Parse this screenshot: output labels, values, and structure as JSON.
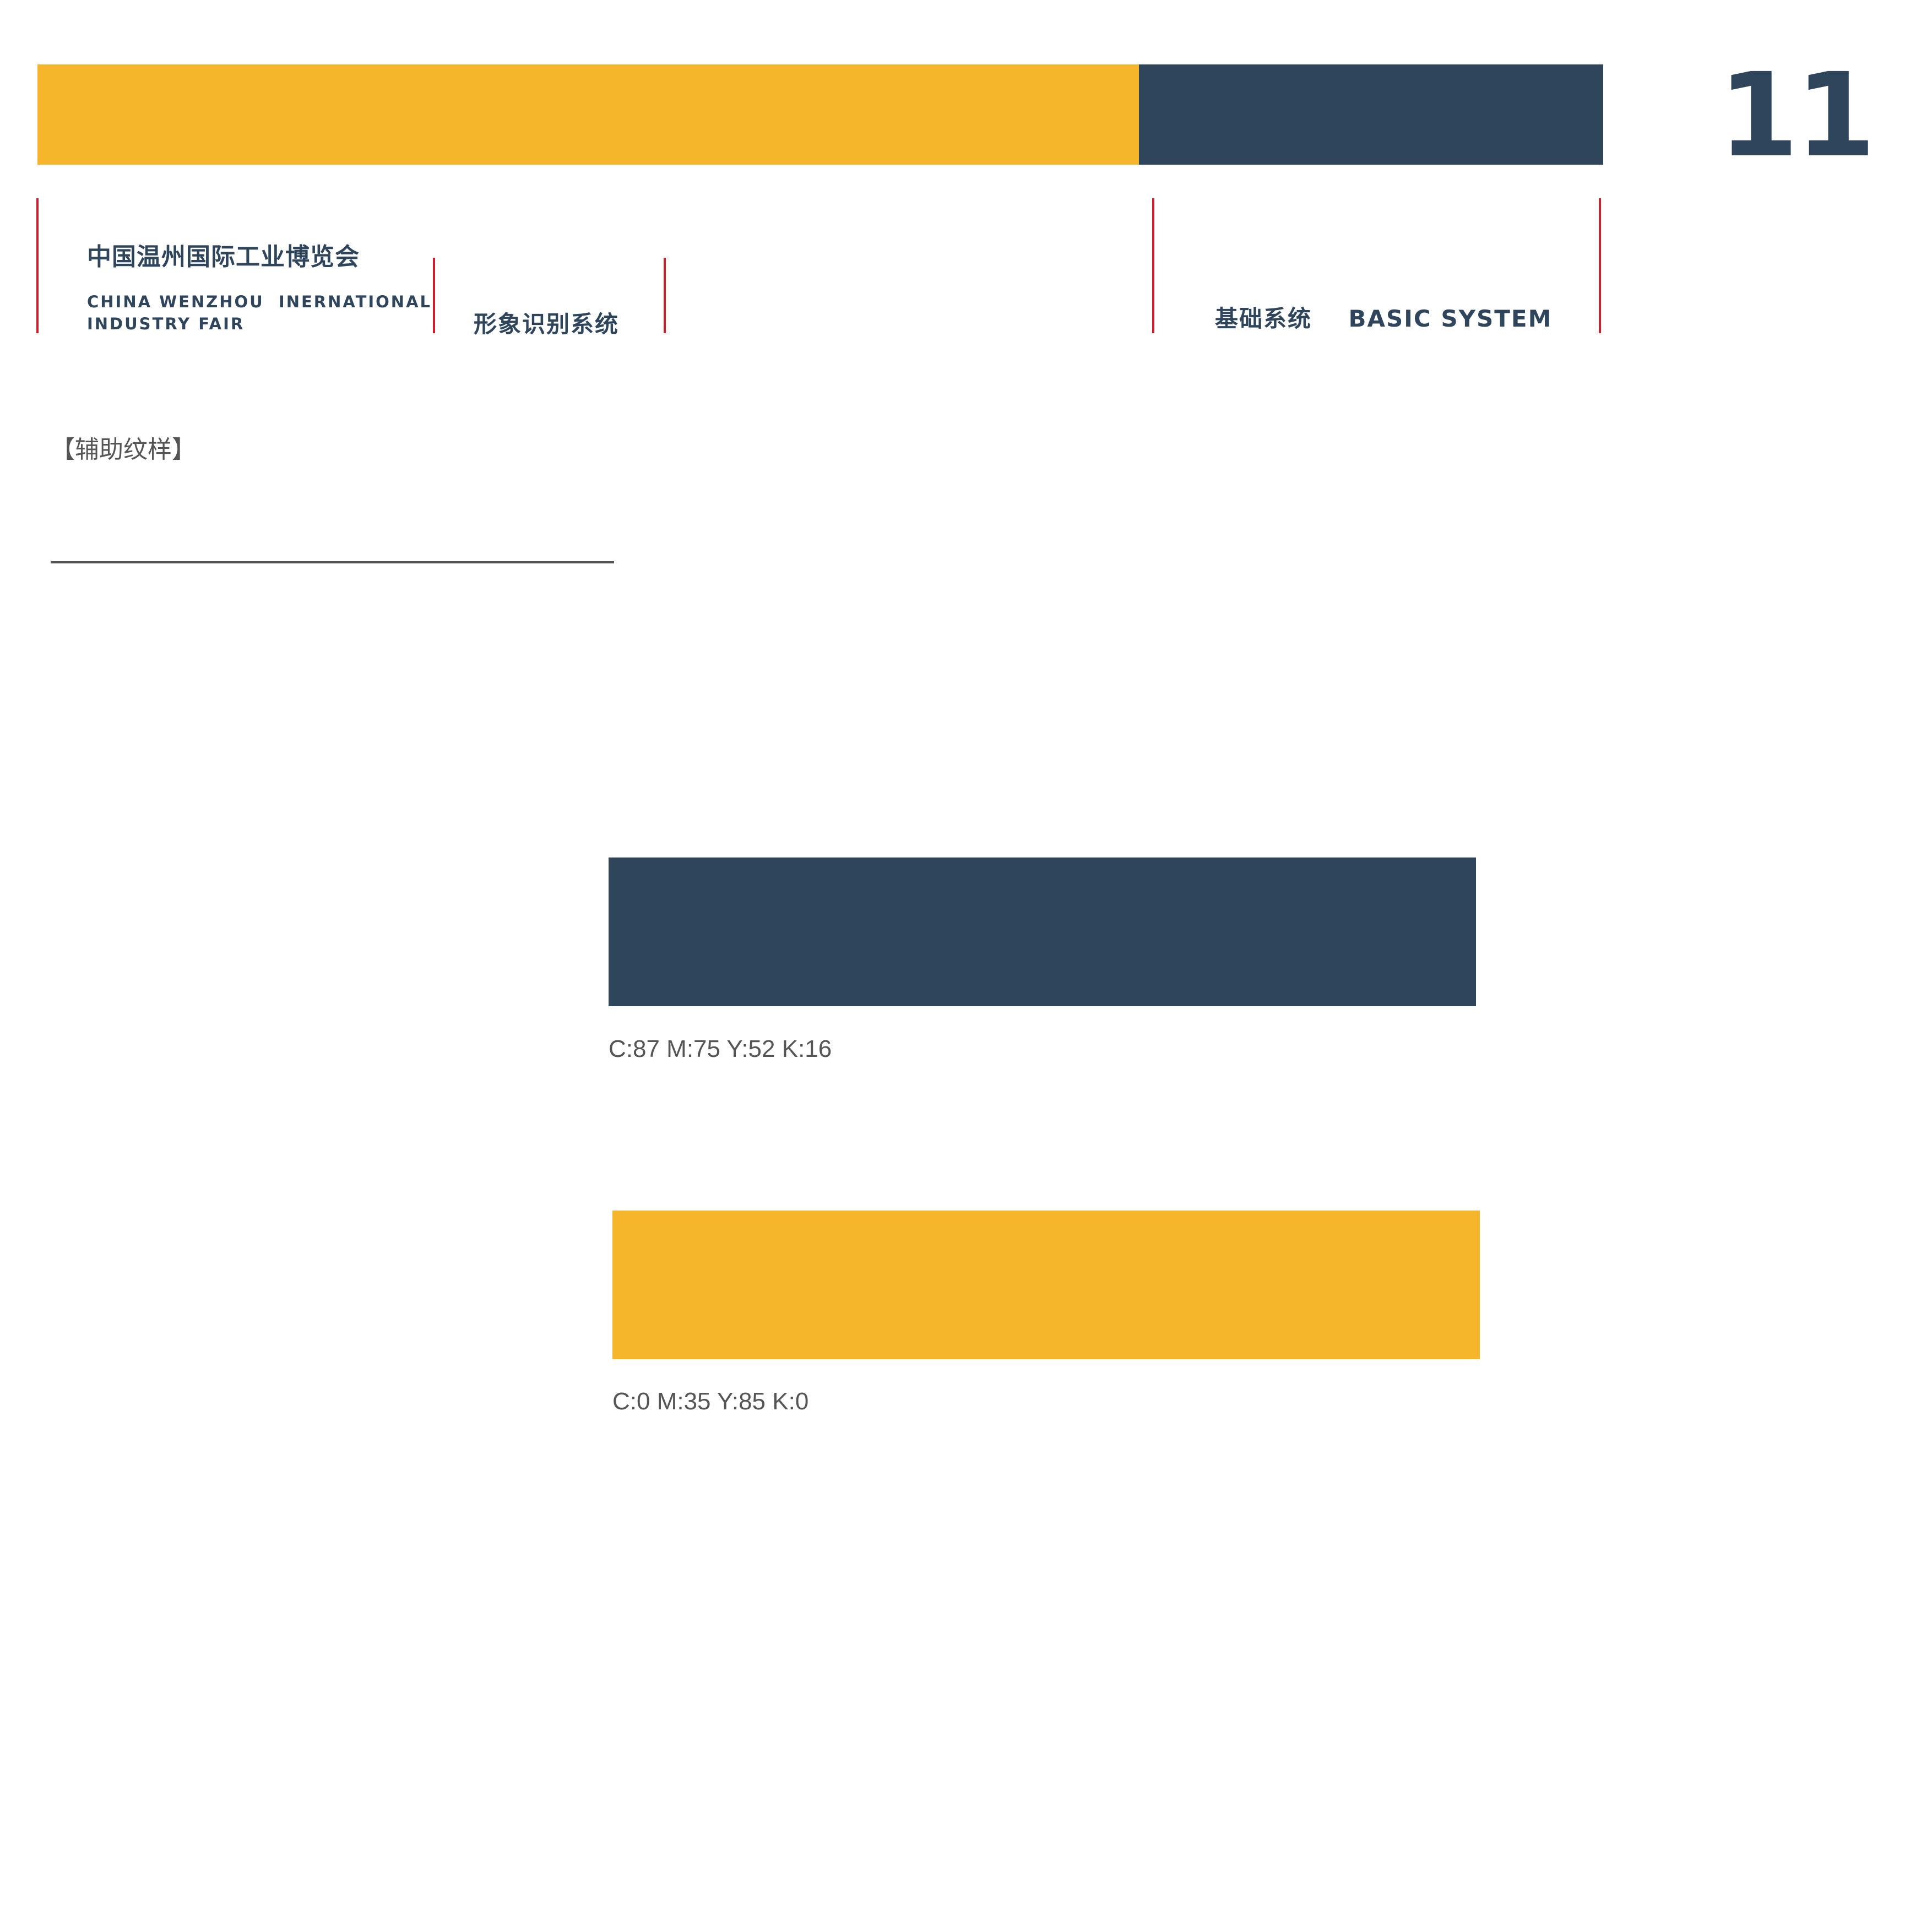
{
  "header": {
    "page_number": "11",
    "colors": {
      "accent_yellow": "#F6B62B",
      "brand_navy": "#2F455C",
      "divider_red": "#C8202E"
    }
  },
  "brand": {
    "cn_name": "中国温州国际工业博览会",
    "en_name_line1": "CHINA WENZHOU  INERNATIONAL",
    "en_name_line2": "INDUSTRY FAIR"
  },
  "manual": {
    "title": "形象识别系统"
  },
  "section": {
    "title": "基础系统    BASIC SYSTEM"
  },
  "content": {
    "label": "【辅助纹样】",
    "swatches": [
      {
        "color": "#2F455C",
        "cmyk": "C:87 M:75 Y:52 K:16"
      },
      {
        "color": "#F6B62B",
        "cmyk": "C:0 M:35 Y:85 K:0"
      }
    ]
  }
}
